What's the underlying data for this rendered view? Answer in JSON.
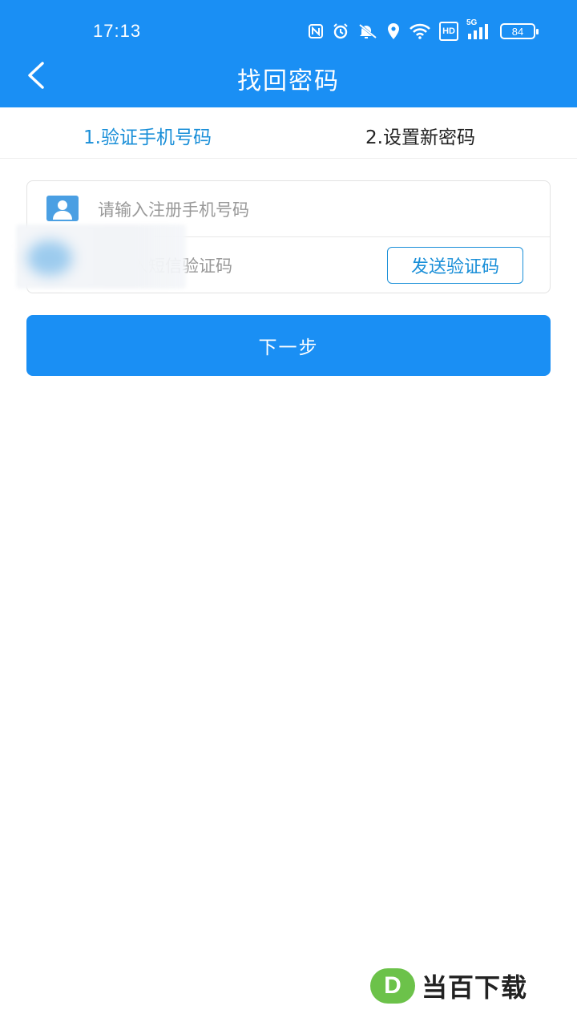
{
  "status_bar": {
    "time": "17:13",
    "hd_label": "HD",
    "signal_label": "5G",
    "battery": "84"
  },
  "header": {
    "title": "找回密码"
  },
  "steps": {
    "step1": "1.验证手机号码",
    "step2": "2.设置新密码"
  },
  "form": {
    "phone_placeholder": "请输入注册手机号码",
    "code_placeholder": "请输入短信验证码",
    "send_code_label": "发送验证码"
  },
  "actions": {
    "next_label": "下一步"
  },
  "watermark": {
    "logo_letter": "D",
    "text": "当百下载"
  },
  "colors": {
    "primary": "#1a8ff4",
    "active_step": "#1a8fd8"
  }
}
